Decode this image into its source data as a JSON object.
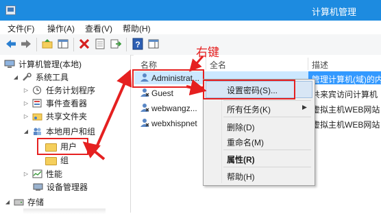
{
  "window": {
    "title": "计算机管理"
  },
  "menu": [
    "文件(F)",
    "操作(A)",
    "查看(V)",
    "帮助(H)"
  ],
  "toolbar_icons": [
    "back-arrow-icon",
    "forward-arrow-icon",
    "up-folder-icon",
    "show-hide-tree-icon",
    "delete-x-icon",
    "properties-icon",
    "export-list-icon",
    "help-icon",
    "action-pane-icon"
  ],
  "tree": {
    "root": "计算机管理(本地)",
    "system_tools": "系统工具",
    "task_scheduler": "任务计划程序",
    "event_viewer": "事件查看器",
    "shared_folders": "共享文件夹",
    "local_users_groups": "本地用户和组",
    "users": "用户",
    "groups": "组",
    "performance": "性能",
    "device_manager": "设备管理器",
    "storage": "存储"
  },
  "list": {
    "headers": [
      "名称",
      "全名",
      "描述"
    ],
    "rows": [
      {
        "name": "Administrat...",
        "fullname": "",
        "desc": "管理计算机(域)的内"
      },
      {
        "name": "Guest",
        "fullname": "",
        "desc": "共来宾访问计算机"
      },
      {
        "name": "webwangz...",
        "fullname": "",
        "desc": "虚拟主机WEB网站"
      },
      {
        "name": "webxhispnet",
        "fullname": "",
        "desc": "虚拟主机WEB网站"
      }
    ]
  },
  "context_menu": {
    "items": [
      "设置密码(S)...",
      "所有任务(K)",
      "删除(D)",
      "重命名(M)",
      "属性(R)",
      "帮助(H)"
    ]
  },
  "annotation": {
    "right_click_label": "右键"
  },
  "colors": {
    "titlebar": "#1d8be0",
    "highlight": "#3399ff",
    "annotation": "#e52020"
  }
}
